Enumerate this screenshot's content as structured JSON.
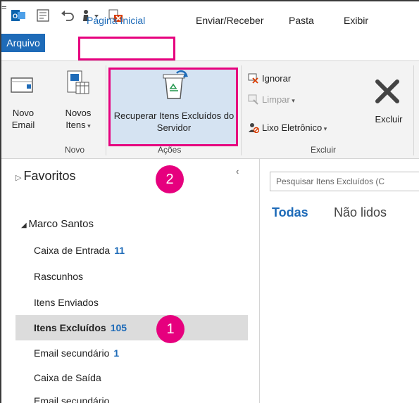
{
  "qat": {
    "more_glyph": "="
  },
  "tabs": {
    "file": "Arquivo",
    "home": "Página Inicial",
    "send_receive": "Enviar/Receber",
    "folder": "Pasta",
    "view": "Exibir"
  },
  "ribbon": {
    "new_group": {
      "label": "Novo",
      "new_email": "Novo Email",
      "new_items": "Novos Itens"
    },
    "actions_group": {
      "label": "Ações",
      "recover": "Recuperar Itens Excluídos do Servidor"
    },
    "delete_group": {
      "label": "Excluir",
      "ignore": "Ignorar",
      "clean": "Limpar",
      "junk": "Lixo Eletrônico",
      "delete": "Excluir"
    }
  },
  "folders": {
    "favorites": "Favoritos",
    "collapse_glyph": "‹",
    "account": "Marco Santos",
    "items": [
      {
        "name": "Caixa de Entrada",
        "count": "11"
      },
      {
        "name": "Rascunhos",
        "count": ""
      },
      {
        "name": "Itens Enviados",
        "count": ""
      },
      {
        "name": "Itens Excluídos",
        "count": "105"
      },
      {
        "name": "Email secundário",
        "count": "1"
      },
      {
        "name": "Caixa de Saída",
        "count": ""
      },
      {
        "name": "Email secundário",
        "count": ""
      }
    ]
  },
  "content": {
    "search_placeholder": "Pesquisar Itens Excluídos (C",
    "filter_all": "Todas",
    "filter_unread": "Não lidos"
  },
  "callouts": {
    "one": "1",
    "two": "2"
  },
  "colors": {
    "accent": "#1e6bb8",
    "highlight": "#e6007e",
    "selected_row": "#dcdcdc",
    "recover_bg": "#d5e3f2"
  },
  "icons": [
    "outlook-icon",
    "send-receive-icon",
    "undo-icon",
    "touch-mode-icon",
    "delete-all-icon",
    "new-email-icon",
    "new-items-icon",
    "recycle-bin-icon",
    "ignore-icon",
    "clean-up-icon",
    "junk-icon",
    "delete-icon",
    "expand-triangle-icon",
    "collapse-triangle-icon"
  ]
}
